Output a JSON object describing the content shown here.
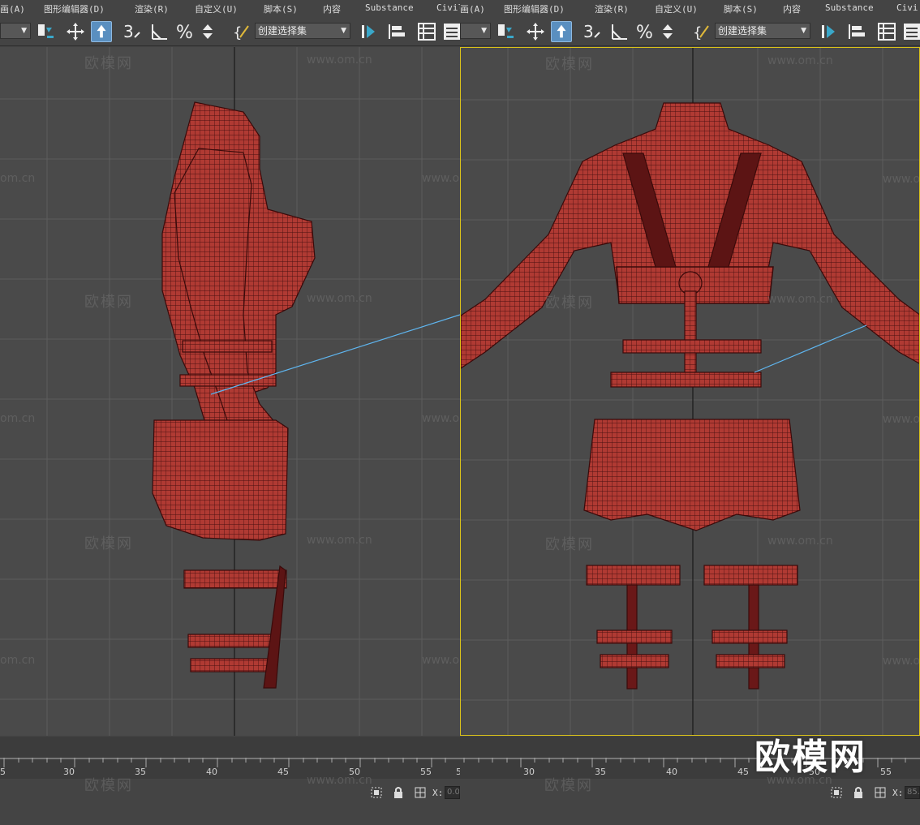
{
  "menus": {
    "left": [
      "画(A)",
      "图形编辑器(D)",
      "渲染(R)",
      "自定义(U)",
      "脚本(S)",
      "内容",
      "Substance",
      "Civil"
    ],
    "right": [
      "画(A)",
      "图形编辑器(D)",
      "渲染(R)",
      "自定义(U)",
      "脚本(S)",
      "内容",
      "Substance",
      "Civi"
    ]
  },
  "toolbar": {
    "selection_set_label": "创建选择集",
    "snap_label": "3",
    "icons": [
      "select-move-icon",
      "move-icon",
      "select-object-icon",
      "snap-3d-icon",
      "angle-snap-icon",
      "percent-snap-icon",
      "spinner-snap-icon",
      "edit-named-selection-icon",
      "mirror-icon",
      "align-icon",
      "layer-explorer-icon",
      "scene-explorer-icon"
    ]
  },
  "watermarks": {
    "cn": "欧模网",
    "url": "www.om.cn",
    "url_short": "om.cn"
  },
  "timeline": {
    "left_ticks": [
      "5",
      "30",
      "35",
      "40",
      "45",
      "50",
      "55",
      "5"
    ],
    "right_ticks": [
      "30",
      "35",
      "40",
      "45",
      "50",
      "55"
    ]
  },
  "status": {
    "x_label": "X:",
    "x_value_left": "0.0",
    "x_value_right": "85."
  },
  "brand": {
    "logo_text": "欧模网"
  },
  "colors": {
    "mesh": "#a8302a",
    "mesh_dark": "#5c1414",
    "viewport_bg": "#4a4a4a",
    "active_border": "#d9c21a",
    "grid": "#5a5a5a"
  }
}
